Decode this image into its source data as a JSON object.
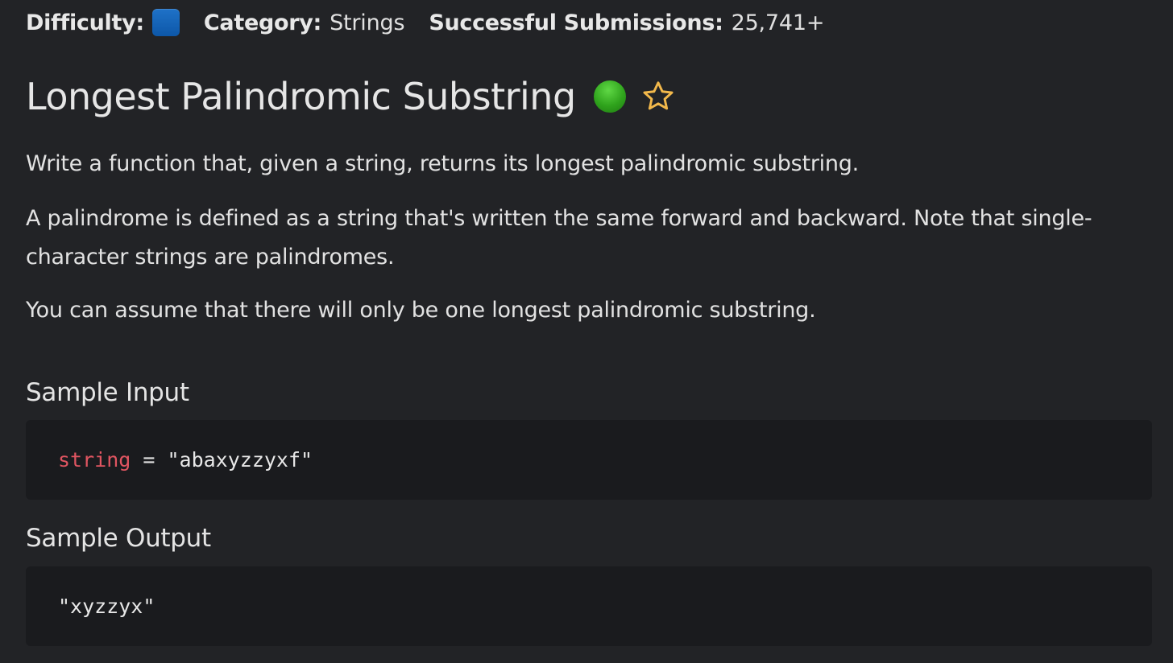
{
  "meta": {
    "difficulty_label": "Difficulty:",
    "difficulty_color": "#1565c0",
    "category_label": "Category:",
    "category_value": "Strings",
    "submissions_label": "Successful Submissions:",
    "submissions_value": "25,741+"
  },
  "problem": {
    "title": "Longest Palindromic Substring",
    "status_color": "#3db82a",
    "status_icon": "green-dot-icon",
    "favorite_icon": "star-outline-icon",
    "favorite_color": "#f2b84b",
    "paragraphs": [
      "Write a function that, given a string, returns its longest palindromic substring.",
      "A palindrome is defined as a string that's written the same forward and backward. Note that single-character strings are palindromes.",
      "You can assume that there will only be one longest palindromic substring."
    ]
  },
  "sample_input": {
    "heading": "Sample Input",
    "var_name": "string",
    "operator": " = ",
    "value": "\"abaxyzzyxf\""
  },
  "sample_output": {
    "heading": "Sample Output",
    "value": "\"xyzzyx\""
  }
}
